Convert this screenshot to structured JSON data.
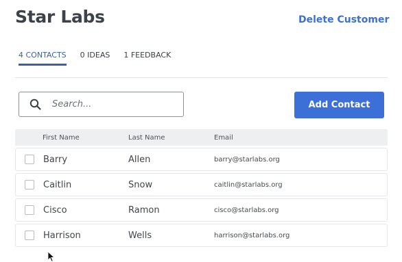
{
  "header": {
    "title": "Star Labs",
    "delete_label": "Delete Customer"
  },
  "tabs": [
    {
      "label": "4 CONTACTS",
      "active": true
    },
    {
      "label": "0 IDEAS",
      "active": false
    },
    {
      "label": "1 FEEDBACK",
      "active": false
    }
  ],
  "search": {
    "placeholder": "Search...",
    "value": "",
    "icon": "search-icon"
  },
  "add_contact_label": "Add Contact",
  "table": {
    "columns": [
      "First Name",
      "Last Name",
      "Email"
    ],
    "rows": [
      {
        "first": "Barry",
        "last": "Allen",
        "email": "barry@starlabs.org"
      },
      {
        "first": "Caitlin",
        "last": "Snow",
        "email": "caitlin@starlabs.org"
      },
      {
        "first": "Cisco",
        "last": "Ramon",
        "email": "cisco@starlabs.org"
      },
      {
        "first": "Harrison",
        "last": "Wells",
        "email": "harrison@starlabs.org"
      }
    ]
  },
  "colors": {
    "accent": "#3d6fd9",
    "tab_active": "#3a5fa8",
    "header_bg": "#eeeff1"
  }
}
